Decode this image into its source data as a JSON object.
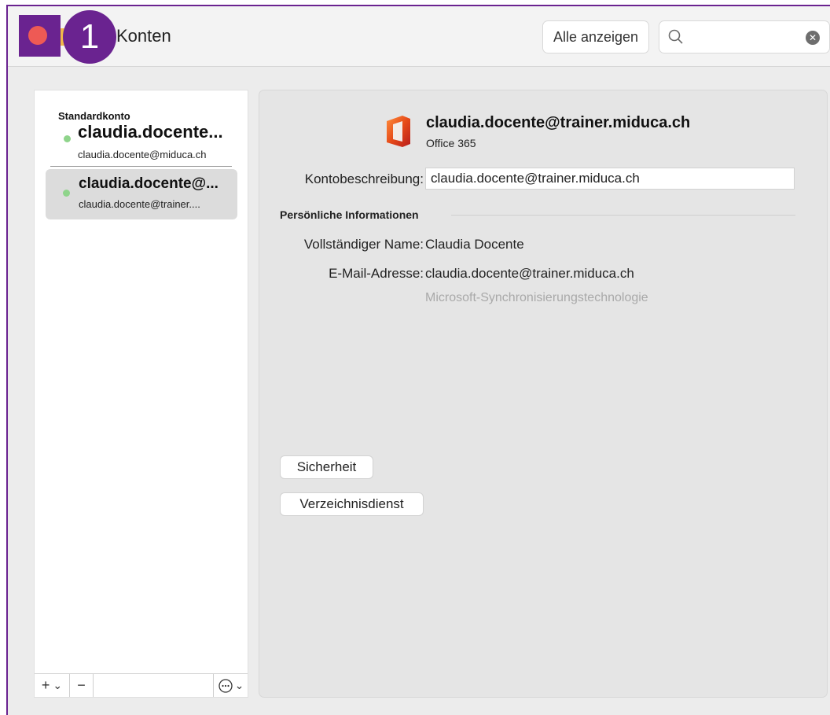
{
  "window": {
    "title": "Konten",
    "show_all_label": "Alle anzeigen",
    "search_placeholder": ""
  },
  "annotation": {
    "marker": "1"
  },
  "sidebar": {
    "default_label": "Standardkonto",
    "accounts": [
      {
        "name": "claudia.docente...",
        "email": "claudia.docente@miduca.ch",
        "status_color": "#8fd48b"
      },
      {
        "name": "claudia.docente@...",
        "email": "claudia.docente@trainer....",
        "status_color": "#8fd48b",
        "selected": true
      }
    ],
    "toolbar": {
      "add": "+",
      "add_menu": "⌄",
      "remove": "−",
      "more": "⋯"
    }
  },
  "detail": {
    "account_title": "claudia.docente@trainer.miduca.ch",
    "account_type": "Office 365",
    "description_label": "Kontobeschreibung:",
    "description_value": "claudia.docente@trainer.miduca.ch",
    "section_personal": "Persönliche Informationen",
    "fullname_label": "Vollständiger Name:",
    "fullname_value": "Claudia Docente",
    "email_label": "E-Mail-Adresse:",
    "email_value": "claudia.docente@trainer.miduca.ch",
    "sync_hint": "Microsoft-Synchronisierungstechnologie",
    "security_button": "Sicherheit",
    "directory_button": "Verzeichnisdienst"
  }
}
